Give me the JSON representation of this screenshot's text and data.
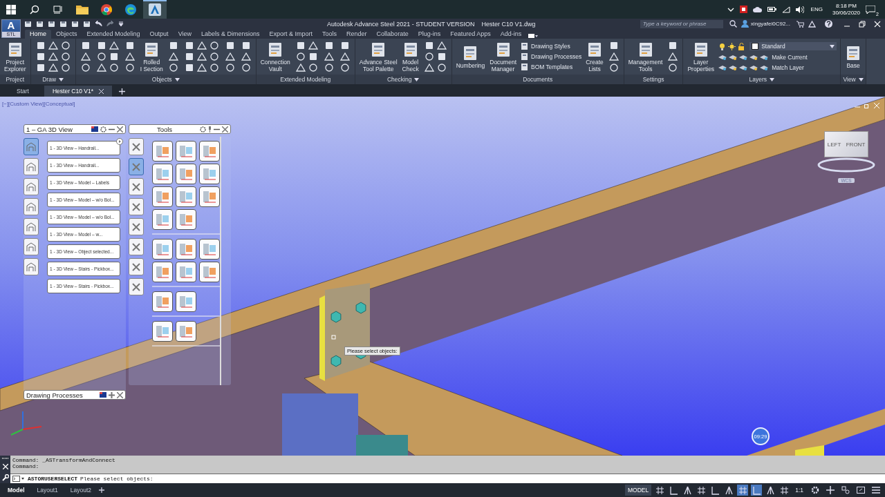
{
  "taskbar": {
    "apps": [
      {
        "kind": "folder",
        "selected": false
      },
      {
        "kind": "chrome",
        "selected": false
      },
      {
        "kind": "edge",
        "selected": false
      },
      {
        "kind": "steel",
        "selected": true
      }
    ],
    "language": "ENG",
    "time": "8:18 PM",
    "date": "30/06/2020",
    "notifications": "2"
  },
  "title_bar": {
    "logo_letter": "A",
    "logo_badge": "STL",
    "title": "Autodesk Advance Steel 2021 - STUDENT VERSION",
    "file": "Hester C10  V1.dwg",
    "search": {
      "placeholder": "Type a keyword or phrase"
    },
    "user": "xingyafei0C92..."
  },
  "ribbon_tabs": [
    {
      "label": "Home",
      "selected": true
    },
    {
      "label": "Objects",
      "selected": false
    },
    {
      "label": "Extended Modeling",
      "selected": false
    },
    {
      "label": "Output",
      "selected": false
    },
    {
      "label": "View",
      "selected": false
    },
    {
      "label": "Labels & Dimensions",
      "selected": false
    },
    {
      "label": "Export & Import",
      "selected": false
    },
    {
      "label": "Tools",
      "selected": false
    },
    {
      "label": "Render",
      "selected": false
    },
    {
      "label": "Collaborate",
      "selected": false
    },
    {
      "label": "Plug-ins",
      "selected": false
    },
    {
      "label": "Featured Apps",
      "selected": false
    },
    {
      "label": "Add-ins",
      "selected": false
    }
  ],
  "ribbon_panels": [
    {
      "title": "Project",
      "menu": false,
      "items": [
        {
          "kind": "large",
          "label": "Project\nExplorer"
        }
      ]
    },
    {
      "title": "Draw",
      "menu": true,
      "items": [
        {
          "kind": "triple"
        }
      ]
    },
    {
      "title": "Objects",
      "menu": true,
      "items": [
        {
          "kind": "single"
        },
        {
          "kind": "pair"
        },
        {
          "kind": "single"
        },
        {
          "kind": "large",
          "label": "Rolled\nI Section"
        },
        {
          "kind": "single"
        },
        {
          "kind": "triple"
        },
        {
          "kind": "single"
        },
        {
          "kind": "single"
        }
      ]
    },
    {
      "title": "Extended Modeling",
      "menu": false,
      "items": [
        {
          "kind": "large",
          "label": "Connection\nVault"
        },
        {
          "kind": "pair"
        },
        {
          "kind": "single"
        },
        {
          "kind": "single"
        }
      ]
    },
    {
      "title": "Checking",
      "menu": true,
      "items": [
        {
          "kind": "large",
          "label": "Advance Steel\nTool Palette"
        },
        {
          "kind": "large",
          "label": "Model\nCheck"
        },
        {
          "kind": "pair"
        }
      ]
    },
    {
      "title": "Documents",
      "menu": false,
      "items": [
        {
          "kind": "large",
          "label": "Numbering"
        },
        {
          "kind": "large",
          "label": "Document\nManager"
        },
        {
          "kind": "list",
          "labels": [
            "Drawing Styles",
            "Drawing Processes",
            "BOM Templates"
          ]
        },
        {
          "kind": "large",
          "label": "Create\nLists"
        },
        {
          "kind": "single"
        }
      ]
    },
    {
      "title": "Settings",
      "menu": false,
      "items": [
        {
          "kind": "large",
          "label": "Management\nTools"
        },
        {
          "kind": "single"
        }
      ]
    },
    {
      "title": "Layers",
      "menu": true,
      "items": [
        {
          "kind": "large",
          "label": "Layer\nProperties"
        },
        {
          "kind": "layers",
          "current": "Standard",
          "actions": [
            "Make Current",
            "Match Layer"
          ]
        }
      ]
    },
    {
      "title": "View",
      "menu": true,
      "items": [
        {
          "kind": "large",
          "label": "Base"
        }
      ]
    }
  ],
  "document_tabs": [
    {
      "label": "Start",
      "selected": false
    },
    {
      "label": "Hester C10  V1*",
      "selected": true
    }
  ],
  "viewport": {
    "label": "[−][Custom View][Conceptual]",
    "tooltip": "Please select objects:",
    "timer": "09:29",
    "viewcube": {
      "left": "LEFT",
      "front": "FRONT",
      "compass": "WCS"
    }
  },
  "view_palette": {
    "title": "1 – GA 3D View",
    "side_tabs": [
      {
        "selected": true
      },
      {
        "selected": false
      },
      {
        "selected": false
      },
      {
        "selected": false
      },
      {
        "selected": false
      },
      {
        "selected": false
      },
      {
        "selected": false
      }
    ],
    "items": [
      "1 - 3D View – Handrail...",
      "1 - 3D View – Handrail...",
      "1 - 3D View – Model – Labels",
      "1 - 3D View – Model – w/o Bol...",
      "1 - 3D View – Model – w/o Bol...",
      "1 - 3D View – Model – w...",
      "1 - 3D View – Object selected...",
      "1 - 3D View – Stairs - Pickbox...",
      "1 - 3D View – Stairs - Pickbox..."
    ]
  },
  "tools_palette": {
    "title": "Tools",
    "side_tabs": [
      {
        "selected": false
      },
      {
        "selected": true
      },
      {
        "selected": false
      },
      {
        "selected": false
      },
      {
        "selected": false
      },
      {
        "selected": false
      },
      {
        "selected": false
      },
      {
        "selected": false
      }
    ]
  },
  "processes_palette": {
    "title": "Drawing Processes"
  },
  "command_line": {
    "history": [
      "Command: _ASTransformAndConnect",
      "Command:"
    ],
    "command": "ASTORUSERSELECT",
    "prompt": "Please select objects:"
  },
  "layout_tabs": [
    {
      "label": "Model",
      "selected": true
    },
    {
      "label": "Layout1",
      "selected": false
    },
    {
      "label": "Layout2",
      "selected": false
    }
  ],
  "status_bar": {
    "space": "MODEL",
    "scale": "1:1",
    "toggles": [
      {
        "on": false
      },
      {
        "on": false
      },
      {
        "on": false
      },
      {
        "on": false
      },
      {
        "on": false
      },
      {
        "on": false
      },
      {
        "on": true
      },
      {
        "on": true
      },
      {
        "on": false
      },
      {
        "on": false
      }
    ]
  }
}
